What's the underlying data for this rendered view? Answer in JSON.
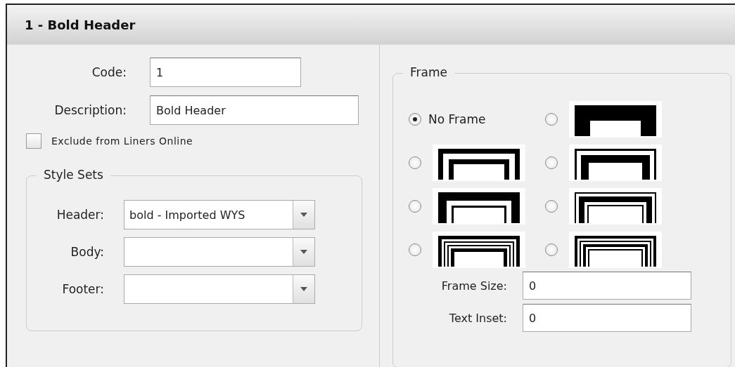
{
  "header": {
    "title": "1 - Bold Header"
  },
  "fields": [
    {
      "label": "Code:",
      "value": "1"
    },
    {
      "label": "Description:",
      "value": "Bold Header"
    }
  ],
  "exclude": {
    "label": "Exclude from Liners Online",
    "checked": false
  },
  "style_sets": {
    "legend": "Style Sets",
    "selects": [
      {
        "label": "Header:",
        "value": "bold - Imported WYS"
      },
      {
        "label": "Body:"
      },
      {
        "label": "Footer:"
      }
    ]
  },
  "frame": {
    "legend": "Frame",
    "options": [
      {
        "kind": "none",
        "label": "No Frame",
        "selected": true
      },
      {
        "kind": "thick",
        "selected": false
      },
      {
        "kind": "double",
        "selected": false
      },
      {
        "kind": "thin-thick",
        "selected": false
      },
      {
        "kind": "thick-thin",
        "selected": false
      },
      {
        "kind": "thin-thick-thin",
        "selected": false
      },
      {
        "kind": "thick-thin-thin-thick",
        "selected": false
      },
      {
        "kind": "thick-thin-thick-thin",
        "selected": false
      }
    ],
    "fields": [
      {
        "label": "Frame Size:",
        "value": "0"
      },
      {
        "label": "Text Inset:",
        "value": "0"
      }
    ]
  }
}
